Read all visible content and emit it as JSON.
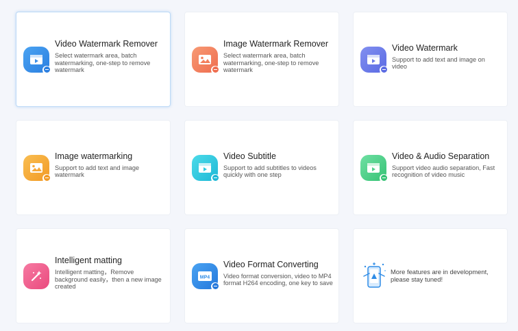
{
  "features": [
    {
      "title": "Video Watermark Remover",
      "desc": "Select watermark area, batch watermarking, one-step to remove watermark",
      "icon": "video-remove-icon",
      "color": "#3a8ee8",
      "selected": true
    },
    {
      "title": "Image Watermark Remover",
      "desc": "Select watermark area, batch watermarking, one-step to remove watermark",
      "icon": "image-remove-icon",
      "color": "#f47f5d"
    },
    {
      "title": "Video Watermark",
      "desc": "Support to add text and image on video",
      "icon": "video-add-icon",
      "color": "#6b7be8"
    },
    {
      "title": "Image watermarking",
      "desc": "Support to add text and image watermark",
      "icon": "image-add-icon",
      "color": "#f6a838"
    },
    {
      "title": "Video Subtitle",
      "desc": "Support to add subtitles to videos quickly with one step",
      "icon": "video-subtitle-icon",
      "color": "#2ecbe0"
    },
    {
      "title": "Video & Audio Separation",
      "desc": "Support video audio separation, Fast recognition of video music",
      "icon": "audio-separation-icon",
      "color": "#4fd28b"
    },
    {
      "title": "Intelligent matting",
      "desc": "Intelligent matting，Remove background easily，then a new image created",
      "icon": "magic-wand-icon",
      "color": "#f05a8c"
    },
    {
      "title": "Video Format Converting",
      "desc": "Video format conversion, video to MP4 format H264 encoding, one key to save",
      "icon": "mp4-convert-icon",
      "color": "#2f8ce6",
      "icon_text": "MP4"
    }
  ],
  "dev_notice": {
    "text": "More features are in development, please stay tuned!",
    "icon": "phone-in-development-icon",
    "color": "#2f8ce6"
  }
}
